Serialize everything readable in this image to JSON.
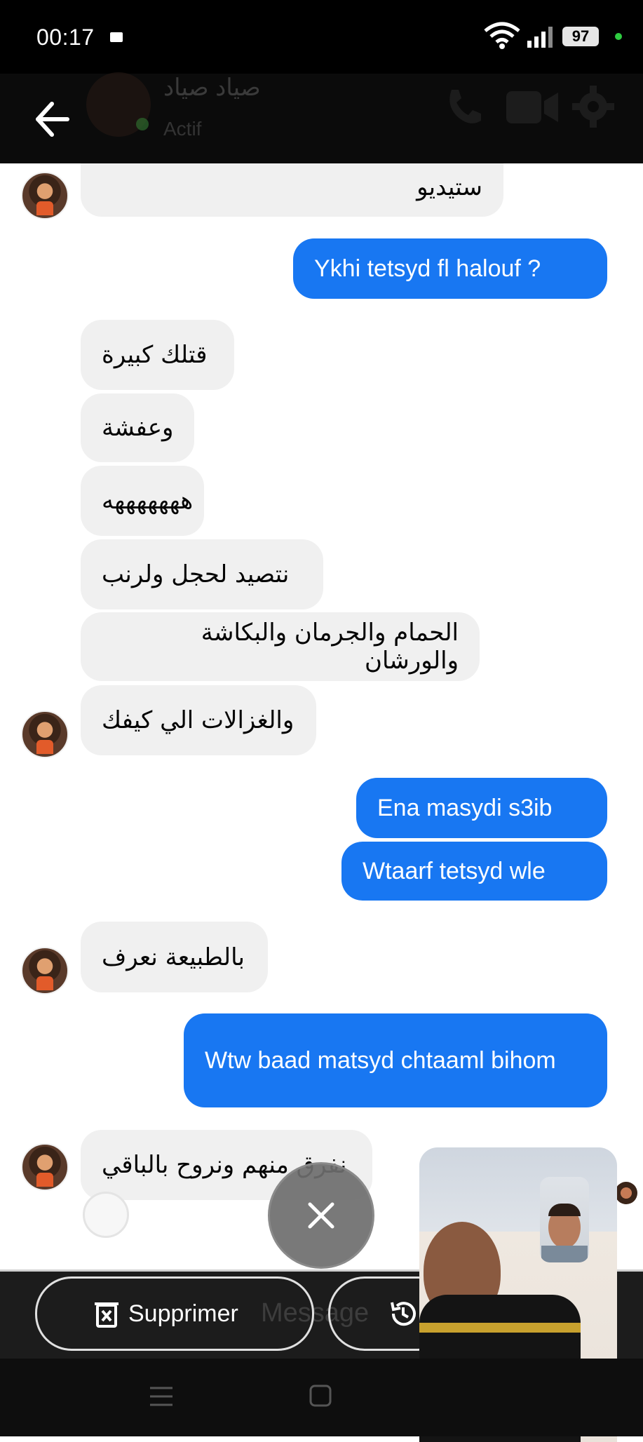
{
  "status_bar": {
    "time": "00:17",
    "battery": "97"
  },
  "header": {
    "contact_name": "صياد صياد",
    "contact_status": "Actif"
  },
  "messages": [
    {
      "side": "in",
      "text": "ستيديو"
    },
    {
      "side": "out",
      "text": "Ykhi tetsyd fl halouf ?"
    },
    {
      "side": "in",
      "text": "قتلك كبيرة"
    },
    {
      "side": "in",
      "text": "وعفشة"
    },
    {
      "side": "in",
      "text": "هههههههه"
    },
    {
      "side": "in",
      "text": "نتصيد لحجل ولرنب"
    },
    {
      "side": "in",
      "text": "الحمام والجرمان والبكاشة والورشان"
    },
    {
      "side": "in",
      "text": "والغزالات الي كيفك"
    },
    {
      "side": "out",
      "text": "Ena masydi s3ib"
    },
    {
      "side": "out",
      "text": "Wtaarf tetsyd wle"
    },
    {
      "side": "in",
      "text": "بالطبيعة نعرف"
    },
    {
      "side": "out",
      "text": "Wtw baad matsyd chtaaml bihom"
    },
    {
      "side": "in",
      "text": "نفرق منهم ونروح بالباقي"
    }
  ],
  "composer": {
    "placeholder": "Message"
  },
  "actions": {
    "delete_label": "Supprimer"
  },
  "icons": [
    "back-arrow-icon",
    "phone-icon",
    "video-camera-icon",
    "gear-icon",
    "trash-icon",
    "history-icon",
    "close-icon",
    "recent-apps-icon",
    "home-icon"
  ],
  "colors": {
    "outgoing_bubble": "#1877f2",
    "incoming_bubble": "#f0f0f0",
    "header_bg": "#0b0b0b"
  }
}
